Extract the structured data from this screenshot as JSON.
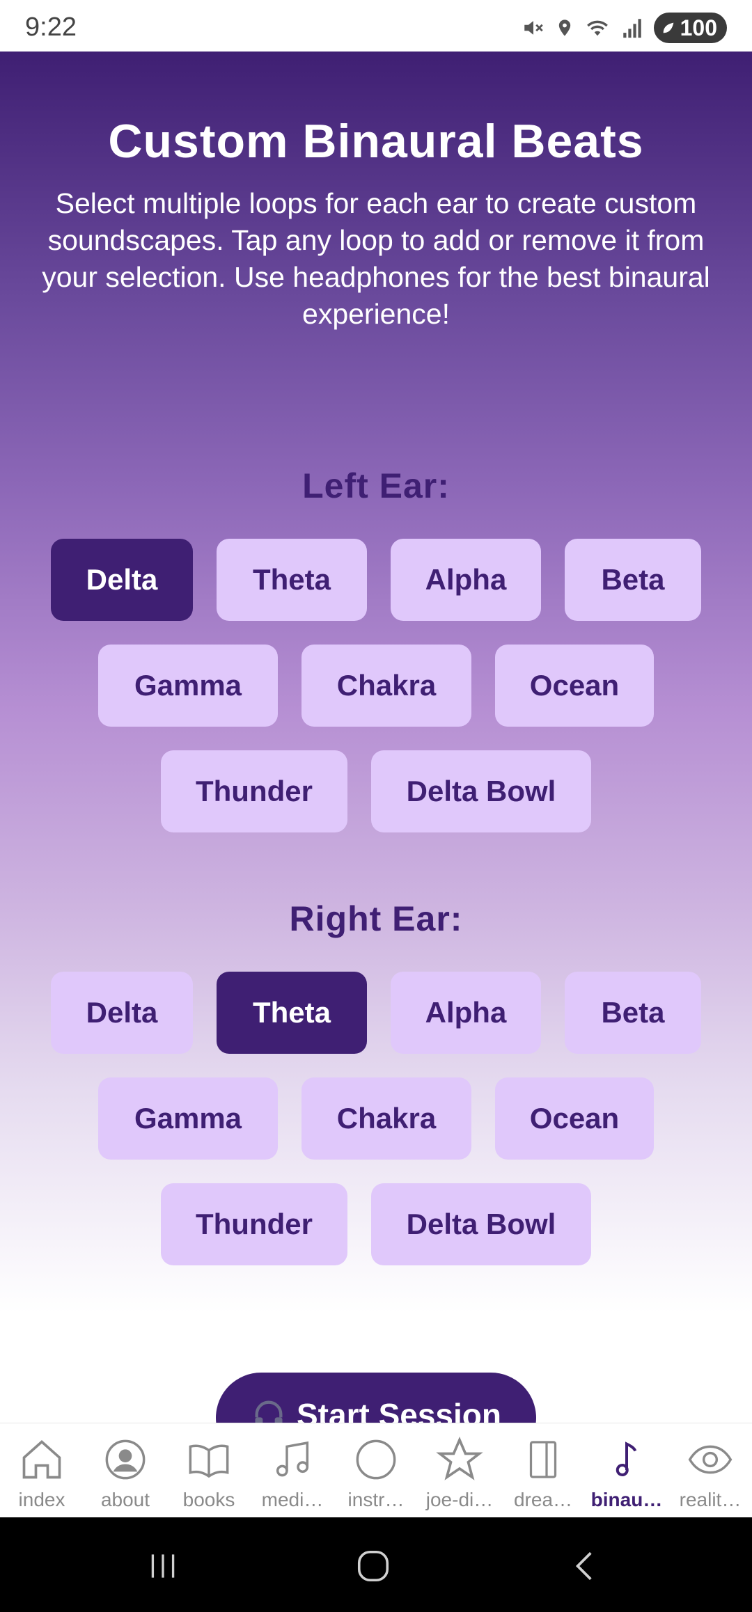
{
  "status_bar": {
    "time": "9:22",
    "battery": "100"
  },
  "page": {
    "title": "Custom Binaural Beats",
    "description": "Select multiple loops for each ear to create custom soundscapes. Tap any loop to add or remove it from your selection. Use headphones for the best binaural experience!"
  },
  "left_ear": {
    "heading": "Left Ear:",
    "loops": [
      {
        "label": "Delta",
        "selected": true
      },
      {
        "label": "Theta",
        "selected": false
      },
      {
        "label": "Alpha",
        "selected": false
      },
      {
        "label": "Beta",
        "selected": false
      },
      {
        "label": "Gamma",
        "selected": false
      },
      {
        "label": "Chakra",
        "selected": false
      },
      {
        "label": "Ocean",
        "selected": false
      },
      {
        "label": "Thunder",
        "selected": false
      },
      {
        "label": "Delta Bowl",
        "selected": false
      }
    ]
  },
  "right_ear": {
    "heading": "Right Ear:",
    "loops": [
      {
        "label": "Delta",
        "selected": false
      },
      {
        "label": "Theta",
        "selected": true
      },
      {
        "label": "Alpha",
        "selected": false
      },
      {
        "label": "Beta",
        "selected": false
      },
      {
        "label": "Gamma",
        "selected": false
      },
      {
        "label": "Chakra",
        "selected": false
      },
      {
        "label": "Ocean",
        "selected": false
      },
      {
        "label": "Thunder",
        "selected": false
      },
      {
        "label": "Delta Bowl",
        "selected": false
      }
    ]
  },
  "start_button": {
    "label": "Start Session",
    "icon": "headphones-icon"
  },
  "tabs": [
    {
      "label": "index",
      "icon": "home-icon",
      "active": false
    },
    {
      "label": "about",
      "icon": "user-circle-icon",
      "active": false
    },
    {
      "label": "books",
      "icon": "book-icon",
      "active": false
    },
    {
      "label": "medi…",
      "icon": "music-note-icon",
      "active": false
    },
    {
      "label": "instr…",
      "icon": "circle-icon",
      "active": false
    },
    {
      "label": "joe-di…",
      "icon": "star-icon",
      "active": false
    },
    {
      "label": "drea…",
      "icon": "door-icon",
      "active": false
    },
    {
      "label": "binau…",
      "icon": "music-note-icon",
      "active": true
    },
    {
      "label": "realit…",
      "icon": "eye-icon",
      "active": false
    }
  ],
  "colors": {
    "primary": "#3f1f73",
    "loop_bg": "#e0c8fb",
    "tab_inactive": "#8a8a8a"
  }
}
